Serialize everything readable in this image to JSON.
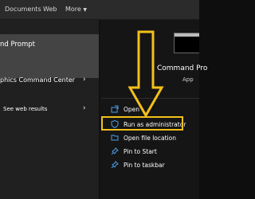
{
  "topbar": {
    "tabs": [
      {
        "label": "Documents"
      },
      {
        "label": "Web"
      },
      {
        "label": "More"
      }
    ],
    "more_arrow": "▼"
  },
  "results": {
    "best_match": "nd Prompt",
    "item2": "phics Command Center",
    "item3": "See web results"
  },
  "details": {
    "app_name": "Command Pro",
    "app_type": "App",
    "actions": [
      {
        "label": "Open",
        "icon": "open-icon"
      },
      {
        "label": "Run as administrator",
        "icon": "shield-icon"
      },
      {
        "label": "Open file location",
        "icon": "folder-icon"
      },
      {
        "label": "Pin to Start",
        "icon": "pin-icon"
      },
      {
        "label": "Pin to taskbar",
        "icon": "pin-icon"
      }
    ]
  },
  "colors": {
    "accent": "#4c9eea",
    "highlight": "#f3c01a",
    "selected": "#444444"
  }
}
